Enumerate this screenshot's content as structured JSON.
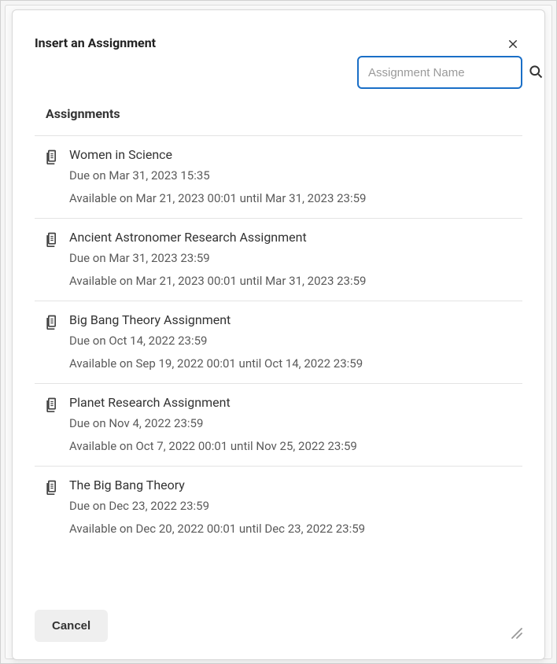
{
  "dialog": {
    "title": "Insert an Assignment",
    "search_placeholder": "Assignment Name",
    "section_label": "Assignments",
    "cancel_label": "Cancel"
  },
  "assignments": [
    {
      "title": "Women in Science",
      "due": "Due on Mar 31, 2023 15:35",
      "available": "Available on Mar 21, 2023 00:01 until Mar 31, 2023 23:59"
    },
    {
      "title": "Ancient Astronomer Research Assignment",
      "due": "Due on Mar 31, 2023 23:59",
      "available": "Available on Mar 21, 2023 00:01 until Mar 31, 2023 23:59"
    },
    {
      "title": "Big Bang Theory Assignment",
      "due": "Due on Oct 14, 2022 23:59",
      "available": "Available on Sep 19, 2022 00:01 until Oct 14, 2022 23:59"
    },
    {
      "title": "Planet Research Assignment",
      "due": "Due on Nov 4, 2022 23:59",
      "available": "Available on Oct 7, 2022 00:01 until Nov 25, 2022 23:59"
    },
    {
      "title": "The Big Bang Theory",
      "due": "Due on Dec 23, 2022 23:59",
      "available": "Available on Dec 20, 2022 00:01 until Dec 23, 2022 23:59"
    }
  ]
}
